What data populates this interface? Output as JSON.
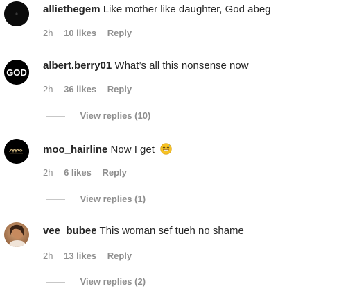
{
  "comments": [
    {
      "username": "alliethegem",
      "text": "Like mother like daughter, God abeg",
      "time": "2h",
      "likes": "10 likes",
      "reply": "Reply",
      "avatar_icon": "dark-avatar-icon"
    },
    {
      "username": "albert.berry01",
      "text": "What’s all this nonsense now",
      "time": "2h",
      "likes": "36 likes",
      "reply": "Reply",
      "view_replies": "View replies (10)",
      "avatar_text": "GOD"
    },
    {
      "username": "moo_hairline",
      "text": "Now I get",
      "emoji": "grinning-sweat-emoji",
      "time": "2h",
      "likes": "6 likes",
      "reply": "Reply",
      "view_replies": "View replies (1)",
      "avatar_icon": "logo-avatar-icon"
    },
    {
      "username": "vee_bubee",
      "text": "This woman sef tueh no shame",
      "time": "2h",
      "likes": "13 likes",
      "reply": "Reply",
      "view_replies": "View replies (2)",
      "avatar_icon": "photo-avatar-icon"
    }
  ]
}
